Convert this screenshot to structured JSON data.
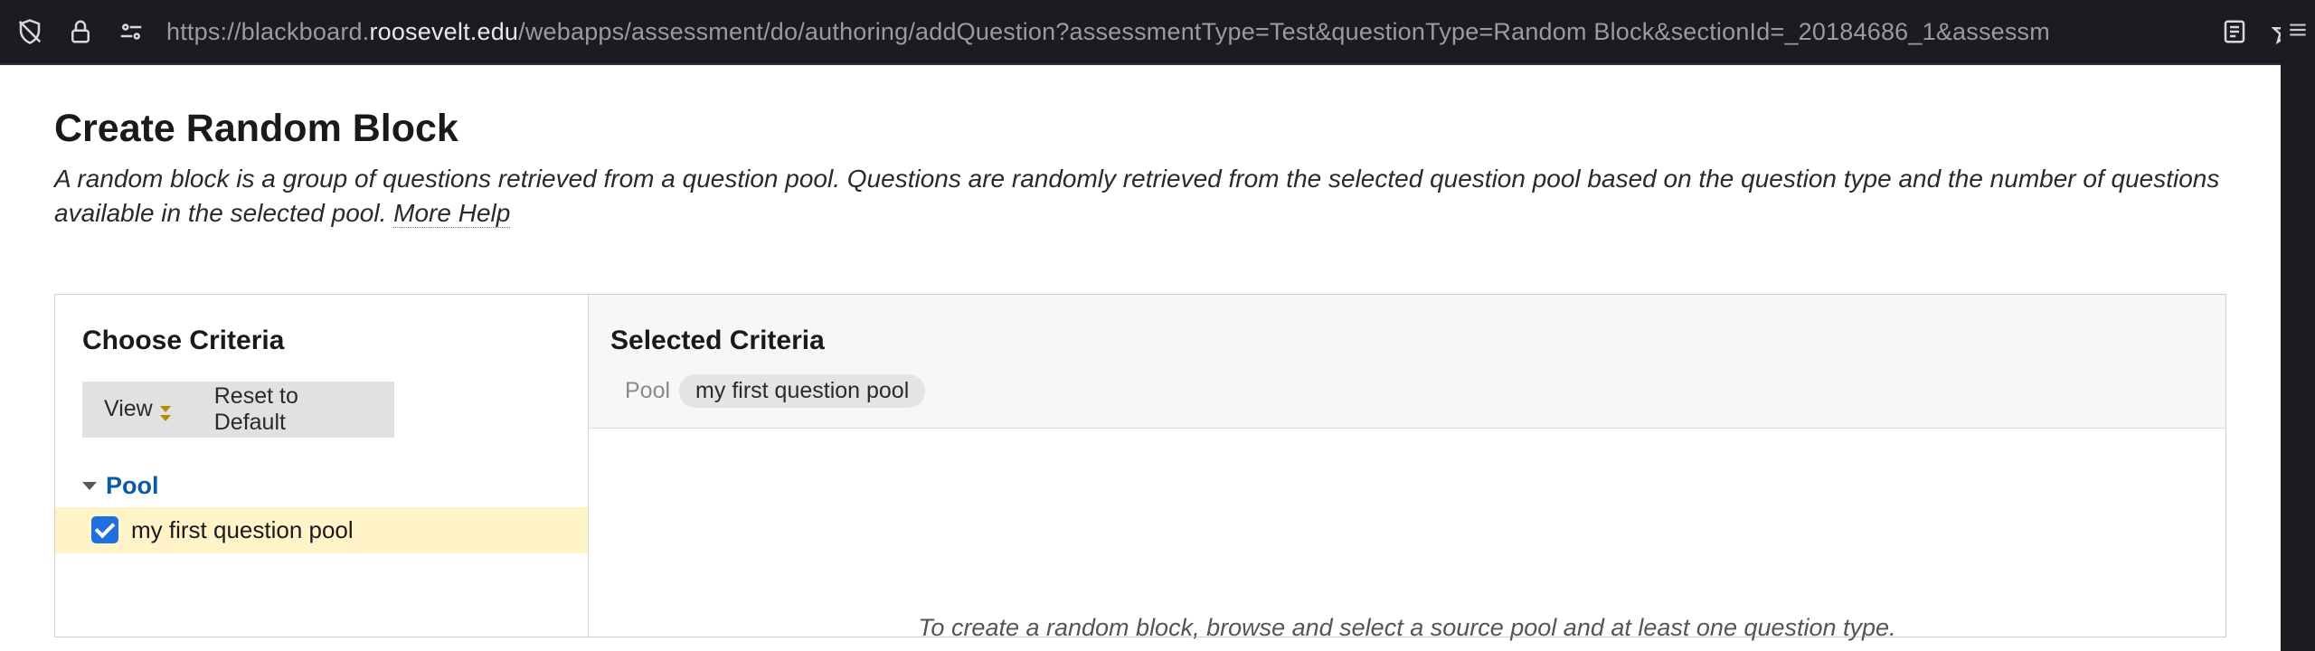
{
  "browser": {
    "url_proto": "https://",
    "url_sub": "blackboard.",
    "url_host": "roosevelt.edu",
    "url_path": "/webapps/assessment/do/authoring/addQuestion?assessmentType=Test&questionType=Random Block&sectionId=_20184686_1&assessm"
  },
  "page": {
    "title": "Create Random Block",
    "description_a": "A random block is a group of questions retrieved from a question pool. Questions are randomly retrieved from the selected question pool based on the question type and the number of questions available in the selected pool. ",
    "more_help": "More Help"
  },
  "left": {
    "header": "Choose Criteria",
    "view": "View",
    "reset": "Reset to Default",
    "pool_header": "Pool",
    "pool_item": "my first question pool"
  },
  "right": {
    "header": "Selected Criteria",
    "pool_label": "Pool",
    "pool_chip": "my first question pool",
    "placeholder": "To create a random block, browse and select a source pool and at least one question type."
  }
}
